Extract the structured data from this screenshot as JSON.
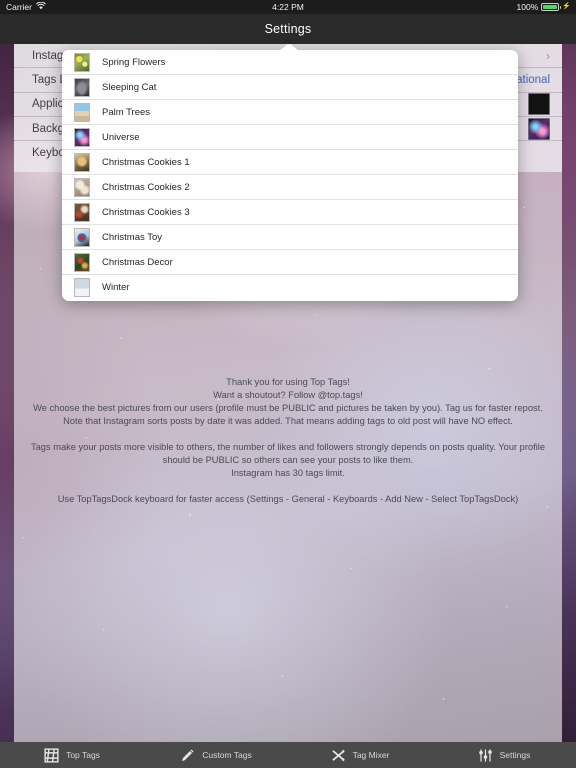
{
  "statusbar": {
    "carrier": "Carrier",
    "wifi_icon": "wifi-icon",
    "time": "4:22 PM",
    "battery_percent": "100%",
    "battery_icon": "battery-full-icon",
    "charging_icon": "charging-bolt-icon"
  },
  "navbar": {
    "title": "Settings"
  },
  "settings": {
    "rows": [
      {
        "label": "Instagram Account",
        "value_type": "chevron",
        "value": "›"
      },
      {
        "label": "Tags Language",
        "value_type": "text",
        "value": "International"
      },
      {
        "label": "Application Theme",
        "value_type": "swatch-black",
        "value": ""
      },
      {
        "label": "Background Image",
        "value_type": "swatch-nebula",
        "value": ""
      },
      {
        "label": "Keyboard Theme",
        "value_type": "none",
        "value": ""
      }
    ]
  },
  "popover": {
    "name": "background-image-picker",
    "items": [
      {
        "label": "Spring Flowers",
        "thumb": "th-flowers"
      },
      {
        "label": "Sleeping Cat",
        "thumb": "th-cat"
      },
      {
        "label": "Palm Trees",
        "thumb": "th-palm"
      },
      {
        "label": "Universe",
        "thumb": "th-universe"
      },
      {
        "label": "Christmas Cookies 1",
        "thumb": "th-cookies1"
      },
      {
        "label": "Christmas Cookies 2",
        "thumb": "th-cookies2"
      },
      {
        "label": "Christmas Cookies 3",
        "thumb": "th-cookies3"
      },
      {
        "label": "Christmas Toy",
        "thumb": "th-toy"
      },
      {
        "label": "Christmas Decor",
        "thumb": "th-decor"
      },
      {
        "label": "Winter",
        "thumb": "th-winter"
      }
    ]
  },
  "info": {
    "lines": [
      {
        "text": "Thank you for using Top Tags!",
        "gap": false
      },
      {
        "text": "Want a shoutout? Follow @top.tags!",
        "gap": false
      },
      {
        "text": "We choose the best pictures from our users (profile must be PUBLIC and pictures be taken by you). Tag us for faster repost.",
        "gap": false
      },
      {
        "text": "Note that Instagram sorts posts by date it was added. That means adding tags to old post will have NO effect.",
        "gap": false
      },
      {
        "text": "Tags make your posts more visible to others, the number of likes and followers strongly depends on posts quality. Your profile should be PUBLIC so others can see your posts to like them.",
        "gap": true
      },
      {
        "text": "Instagram has 30 tags limit.",
        "gap": false
      },
      {
        "text": "Use TopTagsDock keyboard for faster access (Settings - General - Keyboards - Add New - Select TopTagsDock)",
        "gap": true
      }
    ]
  },
  "tabbar": {
    "tabs": [
      {
        "label": "Top Tags",
        "icon": "hashtag-icon"
      },
      {
        "label": "Custom Tags",
        "icon": "pencil-icon"
      },
      {
        "label": "Tag Mixer",
        "icon": "shuffle-icon"
      },
      {
        "label": "Settings",
        "icon": "sliders-icon"
      }
    ]
  },
  "colors": {
    "navbar_bg": "#2a2a2a",
    "statusbar_bg": "#1c1c1c",
    "tabbar_bg": "#4a4a4a",
    "accent_blue": "#4a63b8",
    "battery_green": "#4cd964",
    "popover_bg": "#ffffff"
  }
}
